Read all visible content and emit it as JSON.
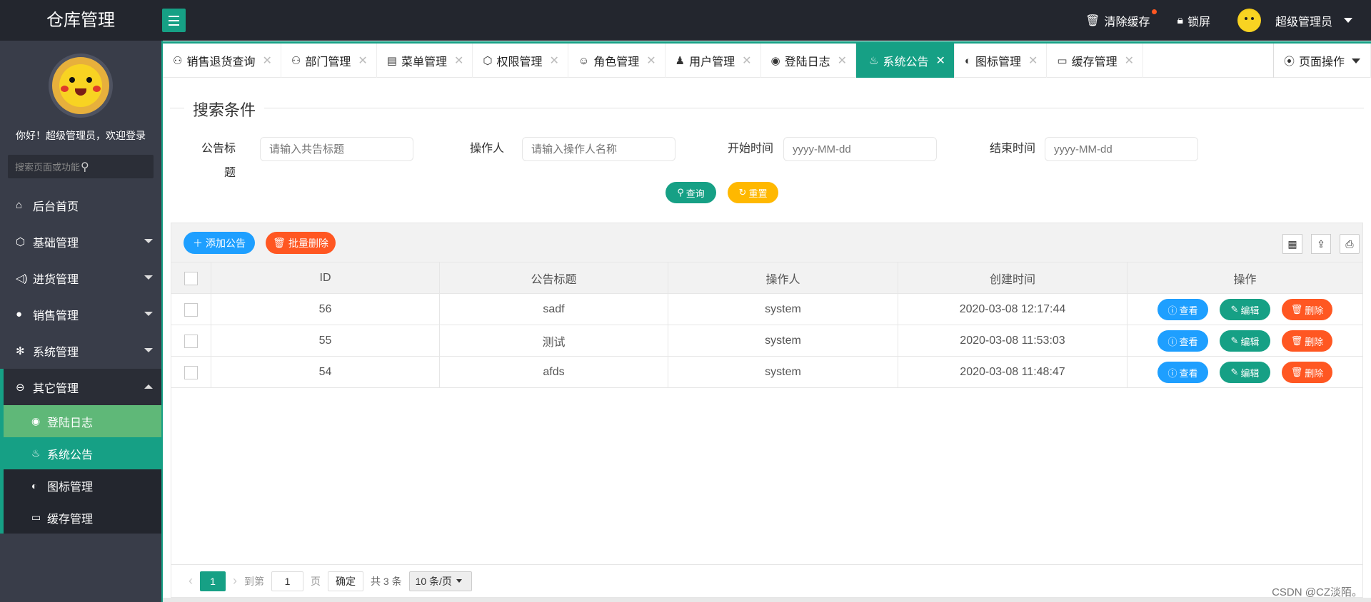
{
  "app": {
    "title": "仓库管理"
  },
  "header": {
    "clear_cache": "清除缓存",
    "lock_screen": "锁屏",
    "user_name": "超级管理员"
  },
  "sidebar": {
    "welcome": "你好！超级管理员，欢迎登录",
    "search_placeholder": "搜索页面或功能",
    "items": [
      {
        "label": "后台首页",
        "icon": "home-icon"
      },
      {
        "label": "基础管理",
        "icon": "cube-icon"
      },
      {
        "label": "进货管理",
        "icon": "volume-icon"
      },
      {
        "label": "销售管理",
        "icon": "chat-icon"
      },
      {
        "label": "系统管理",
        "icon": "gear-icon"
      },
      {
        "label": "其它管理",
        "icon": "logout-icon"
      }
    ],
    "subitems": [
      {
        "label": "登陆日志",
        "icon": "weibo-icon"
      },
      {
        "label": "系统公告",
        "icon": "fire-icon"
      },
      {
        "label": "图标管理",
        "icon": "compass-icon"
      },
      {
        "label": "缓存管理",
        "icon": "cache-icon"
      }
    ]
  },
  "tabs": [
    {
      "label": "销售退货查询",
      "icon": "user-outline-icon"
    },
    {
      "label": "部门管理",
      "icon": "user-outline-icon"
    },
    {
      "label": "菜单管理",
      "icon": "menu-icon"
    },
    {
      "label": "权限管理",
      "icon": "cube-icon"
    },
    {
      "label": "角色管理",
      "icon": "smile-icon"
    },
    {
      "label": "用户管理",
      "icon": "user-icon"
    },
    {
      "label": "登陆日志",
      "icon": "weibo-icon"
    },
    {
      "label": "系统公告",
      "icon": "fire-icon",
      "active": true
    },
    {
      "label": "图标管理",
      "icon": "compass-icon"
    },
    {
      "label": "缓存管理",
      "icon": "cache-icon"
    }
  ],
  "page_ops": "页面操作",
  "search": {
    "legend": "搜索条件",
    "title_label": "公告标题",
    "title_placeholder": "请输入共告标题",
    "operator_label": "操作人",
    "operator_placeholder": "请输入操作人名称",
    "start_label": "开始时间",
    "start_placeholder": "yyyy-MM-dd",
    "end_label": "结束时间",
    "end_placeholder": "yyyy-MM-dd",
    "query_btn": "查询",
    "reset_btn": "重置"
  },
  "toolbar": {
    "add_btn": "添加公告",
    "batch_delete_btn": "批量删除"
  },
  "table": {
    "columns": [
      "ID",
      "公告标题",
      "操作人",
      "创建时间",
      "操作"
    ],
    "rows": [
      {
        "id": "56",
        "title": "sadf",
        "operator": "system",
        "created": "2020-03-08 12:17:44"
      },
      {
        "id": "55",
        "title": "测试",
        "operator": "system",
        "created": "2020-03-08 11:53:03"
      },
      {
        "id": "54",
        "title": "afds",
        "operator": "system",
        "created": "2020-03-08 11:48:47"
      }
    ],
    "actions": {
      "view": "查看",
      "edit": "编辑",
      "delete": "删除"
    }
  },
  "pager": {
    "current": "1",
    "goto_label": "到第",
    "goto_value": "1",
    "page_label": "页",
    "confirm": "确定",
    "total": "共 3 条",
    "page_size": "10 条/页"
  },
  "watermark": "CSDN @CZ淡陌。",
  "colors": {
    "accent": "#16a085",
    "blue": "#1e9fff",
    "orange": "#ff5722",
    "yellow": "#ffb800",
    "sidebar": "#393d49",
    "header": "#23262e"
  }
}
